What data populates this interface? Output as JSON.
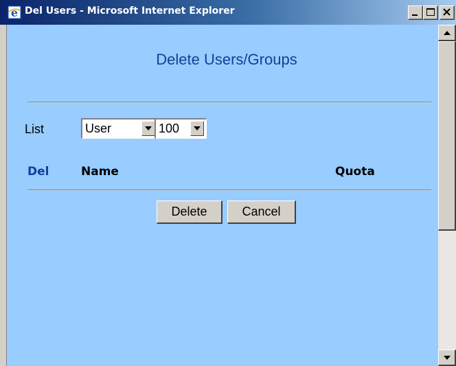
{
  "window": {
    "title": "Del Users - Microsoft Internet Explorer",
    "titlebar_color": "#0a246a",
    "content_background": "#99ccff"
  },
  "page": {
    "heading": "Delete Users/Groups",
    "list_label": "List",
    "type_select": {
      "selected": "User"
    },
    "count_select": {
      "selected": "100"
    },
    "columns": {
      "del": "Del",
      "name": "Name",
      "quota": "Quota"
    },
    "buttons": {
      "delete": "Delete",
      "cancel": "Cancel"
    }
  },
  "icons": [
    "ie-icon",
    "minimize-icon",
    "maximize-icon",
    "close-icon",
    "chevron-down-icon",
    "scroll-up-icon",
    "scroll-down-icon"
  ]
}
